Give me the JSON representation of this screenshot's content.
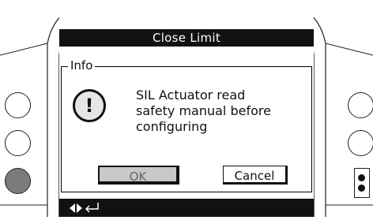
{
  "dialog": {
    "title": "Close Limit",
    "group_label": "Info",
    "icon": "alert-exclamation-icon",
    "icon_glyph": "!",
    "message_lines": [
      "SIL Actuator read",
      "safety manual before",
      "configuring"
    ],
    "ok_label": "OK",
    "cancel_label": "Cancel"
  },
  "navigation": {
    "icons": [
      "left-right-arrows-icon",
      "enter-return-icon"
    ]
  },
  "colors": {
    "bar_background": "#111111",
    "bar_text": "#ffffff",
    "ok_button_fill": "#c8c8c8",
    "pressed_side_button": "#7c7c7c"
  }
}
